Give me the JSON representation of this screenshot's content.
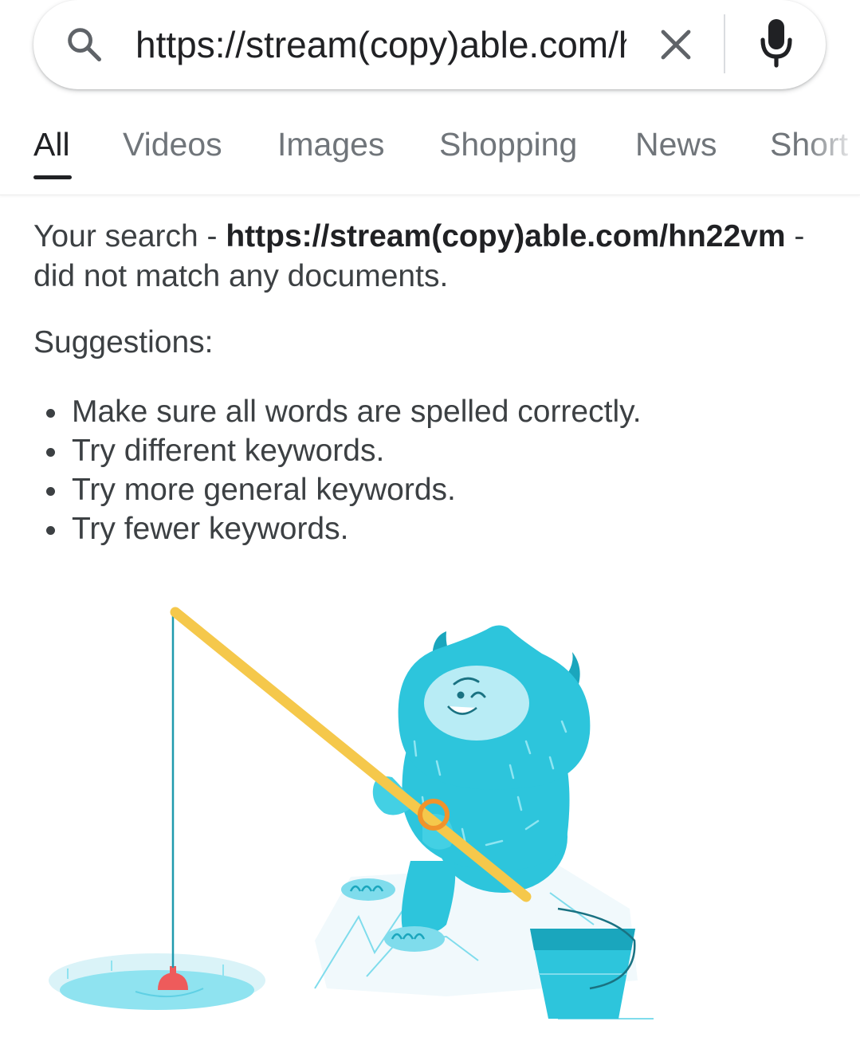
{
  "search": {
    "query": "https://stream(copy)able.com/hn22vm",
    "icon": "search-icon",
    "clear_icon": "close-icon",
    "voice_icon": "mic-icon"
  },
  "tabs": [
    {
      "label": "All",
      "active": true
    },
    {
      "label": "Videos",
      "active": false
    },
    {
      "label": "Images",
      "active": false
    },
    {
      "label": "Shopping",
      "active": false
    },
    {
      "label": "News",
      "active": false
    },
    {
      "label": "Short",
      "active": false
    }
  ],
  "results": {
    "prefix": "Your search - ",
    "query": "https://stream(copy)able.com/hn22vm",
    "suffix": " - did not match any documents.",
    "suggestions_label": "Suggestions:",
    "suggestions": [
      "Make sure all words are spelled correctly.",
      "Try different keywords.",
      "Try more general keywords.",
      "Try fewer keywords."
    ]
  },
  "colors": {
    "accent_text": "#202124",
    "secondary_text": "#70757a",
    "body_text": "#3c4043",
    "yeti": "#2dc5dc",
    "rod": "#f5c84b",
    "bobber": "#ee5b5b"
  }
}
